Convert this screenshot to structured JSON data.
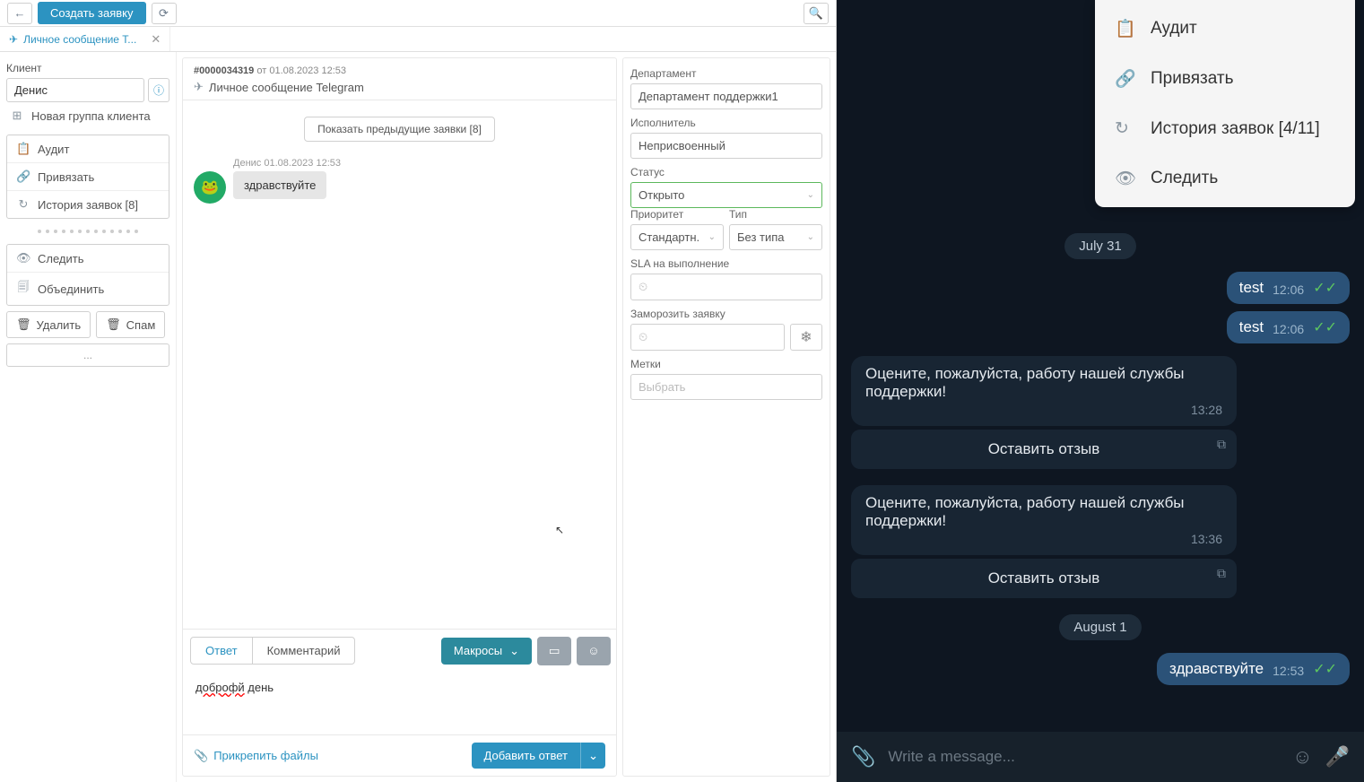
{
  "toolbar": {
    "create_ticket": "Создать заявку"
  },
  "tab": {
    "title": "Личное сообщение Т..."
  },
  "client": {
    "label": "Клиент",
    "name": "Денис",
    "new_group": "Новая группа клиента"
  },
  "side_actions": {
    "audit": "Аудит",
    "link": "Привязать",
    "history": "История заявок [8]",
    "watch": "Следить",
    "merge": "Объединить",
    "delete": "Удалить",
    "spam": "Спам",
    "more": "..."
  },
  "ticket": {
    "id": "#0000034319",
    "date_prefix": "от",
    "date": "01.08.2023 12:53",
    "title": "Личное сообщение Telegram",
    "show_prev": "Показать предыдущие заявки [8]"
  },
  "message": {
    "author": "Денис",
    "date": "01.08.2023 12:53",
    "text": "здравствуйте"
  },
  "reply": {
    "tab_answer": "Ответ",
    "tab_comment": "Комментарий",
    "macros": "Макросы",
    "draft_typo": "доброфй",
    "draft_rest": " день",
    "attach": "Прикрепить файлы",
    "add": "Добавить ответ"
  },
  "props": {
    "department_label": "Департамент",
    "department_value": "Департамент поддержки1",
    "assignee_label": "Исполнитель",
    "assignee_value": "Неприсвоенный",
    "status_label": "Статус",
    "status_value": "Открыто",
    "priority_label": "Приоритет",
    "priority_value": "Стандартн.",
    "type_label": "Тип",
    "type_value": "Без типа",
    "sla_label": "SLA на выполнение",
    "freeze_label": "Заморозить заявку",
    "tags_label": "Метки",
    "tags_placeholder": "Выбрать"
  },
  "tg_menu": {
    "audit": "Аудит",
    "link": "Привязать",
    "history": "История заявок [4/11]",
    "watch": "Следить"
  },
  "tg_dates": {
    "jul31": "July 31",
    "aug1": "August 1"
  },
  "tg_msgs": {
    "test1_text": "test",
    "test1_time": "12:06",
    "test2_text": "test",
    "test2_time": "12:06",
    "rate1_text": "Оцените, пожалуйста, работу нашей службы поддержки!",
    "rate1_time": "13:28",
    "review_btn": "Оставить отзыв",
    "rate2_text": "Оцените, пожалуйста, работу нашей службы поддержки!",
    "rate2_time": "13:36",
    "hello_text": "здравствуйте",
    "hello_time": "12:53"
  },
  "tg_input": {
    "placeholder": "Write a message..."
  }
}
